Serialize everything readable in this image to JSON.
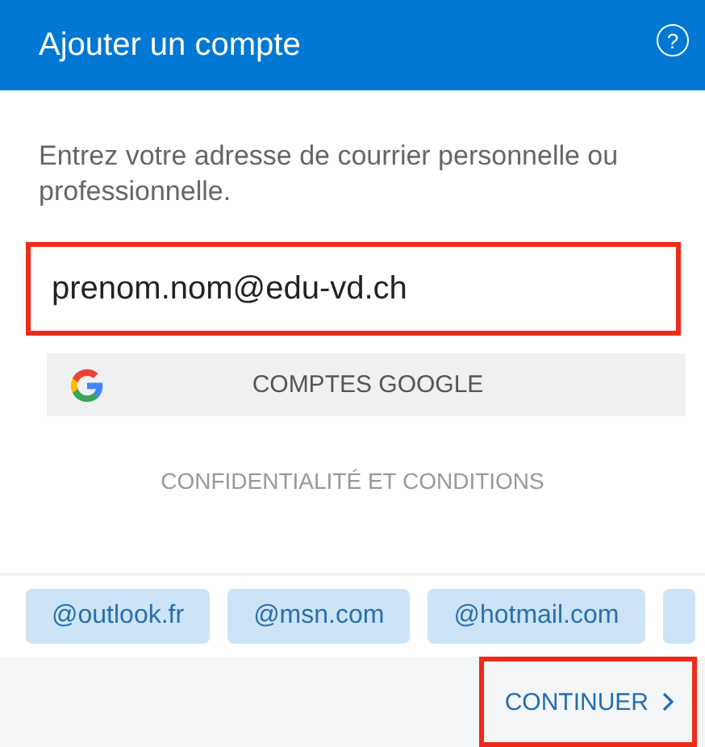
{
  "header": {
    "title": "Ajouter un compte",
    "help_icon": "?"
  },
  "prompt": "Entrez votre adresse de courrier personnelle ou professionnelle.",
  "email_field": {
    "value": "prenom.nom@edu-vd.ch",
    "highlighted": true
  },
  "google_button": {
    "label": "COMPTES GOOGLE"
  },
  "privacy_link": "CONFIDENTIALITÉ ET CONDITIONS",
  "suggestions": [
    {
      "label": "@outlook.fr"
    },
    {
      "label": "@msn.com"
    },
    {
      "label": "@hotmail.com"
    }
  ],
  "continue_button": {
    "label": "CONTINUER",
    "highlighted": true
  }
}
